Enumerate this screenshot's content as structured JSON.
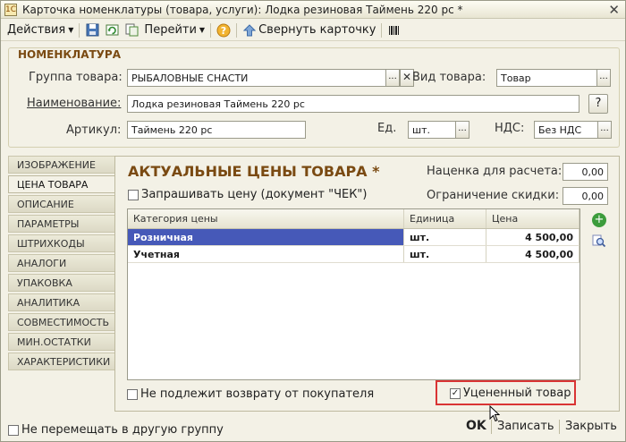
{
  "window": {
    "title": "Карточка номенклатуры (товара, услуги): Лодка резиновая Таймень 220 рс *",
    "close_glyph": "✕"
  },
  "toolbar": {
    "actions_label": "Действия",
    "goto_label": "Перейти",
    "collapse_label": "Свернуть карточку"
  },
  "group": {
    "title": "НОМЕНКЛАТУРА",
    "group_label": "Группа товара:",
    "group_value": "РЫБАЛОВНЫЕ СНАСТИ",
    "type_label": "Вид товара:",
    "type_value": "Товар",
    "name_label": "Наименование:",
    "name_value": "Лодка резиновая Таймень 220 рс",
    "article_label": "Артикул:",
    "article_value": "Таймень 220 рс",
    "unit_label": "Ед.",
    "unit_value": "шт.",
    "vat_label": "НДС:",
    "vat_value": "Без НДС",
    "ellipsis": "...",
    "clear": "✕",
    "help": "?"
  },
  "tabs": [
    {
      "label": "ИЗОБРАЖЕНИЕ"
    },
    {
      "label": "ЦЕНА ТОВАРА"
    },
    {
      "label": "ОПИСАНИЕ"
    },
    {
      "label": "ПАРАМЕТРЫ"
    },
    {
      "label": "ШТРИХКОДЫ"
    },
    {
      "label": "АНАЛОГИ"
    },
    {
      "label": "УПАКОВКА"
    },
    {
      "label": "АНАЛИТИКА"
    },
    {
      "label": "СОВМЕСТИМОСТЬ"
    },
    {
      "label": "МИН.ОСТАТКИ"
    },
    {
      "label": "ХАРАКТЕРИСТИКИ"
    }
  ],
  "prices": {
    "title": "АКТУАЛЬНЫЕ ЦЕНЫ ТОВАРА *",
    "ask_price_label": "Запрашивать цену (документ \"ЧЕК\")",
    "markup_label": "Наценка для расчета:",
    "markup_value": "0,00",
    "discount_label": "Ограничение скидки:",
    "discount_value": "0,00",
    "columns": [
      "Категория цены",
      "Единица",
      "Цена"
    ],
    "rows": [
      {
        "category": "Розничная",
        "unit": "шт.",
        "price": "4 500,00"
      },
      {
        "category": "Учетная",
        "unit": "шт.",
        "price": "4 500,00"
      }
    ],
    "no_return_label": "Не подлежит возврату от покупателя",
    "discounted_label": "Уцененный товар",
    "check_mark": "✓"
  },
  "footer": {
    "no_move_label": "Не перемещать в другую группу",
    "ok_label": "OK",
    "save_label": "Записать",
    "close_label": "Закрыть"
  }
}
